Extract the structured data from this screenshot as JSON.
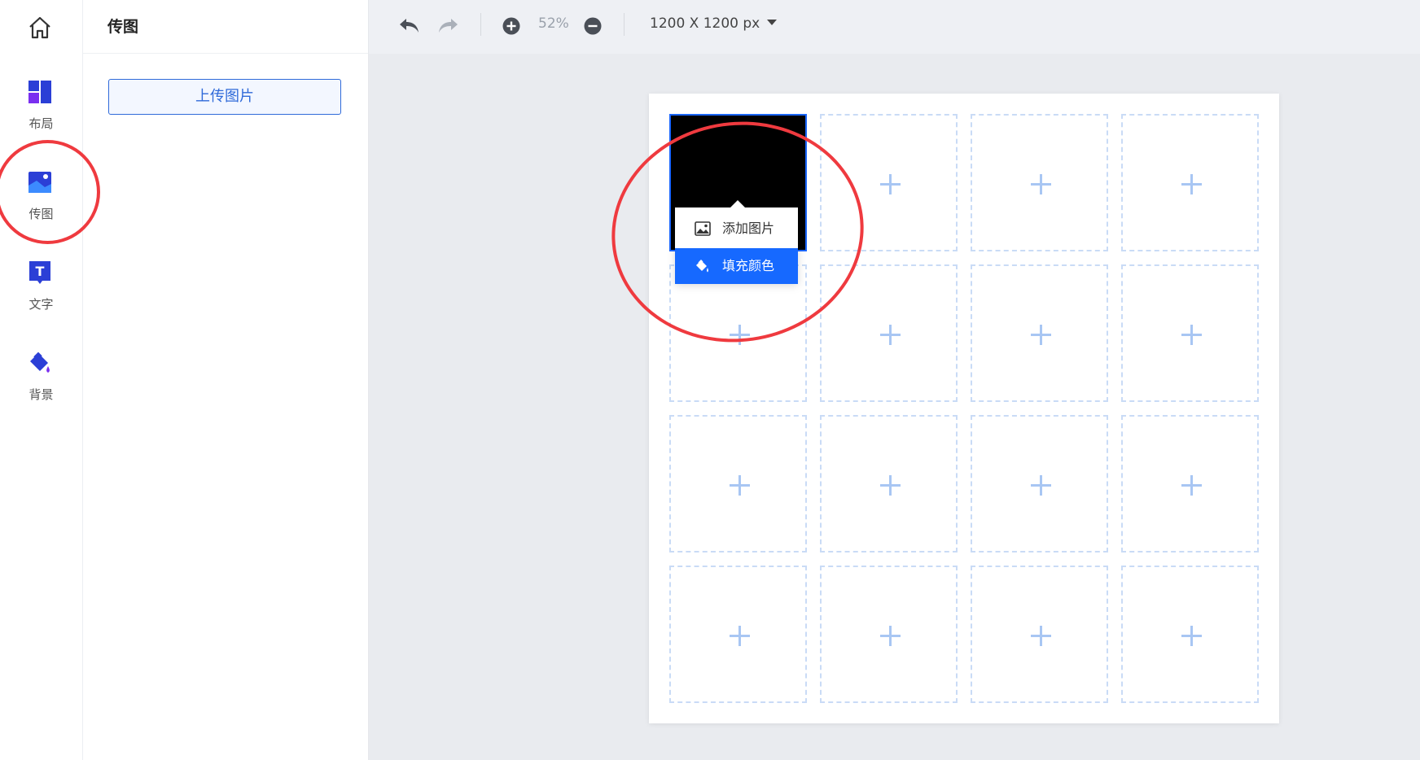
{
  "nav": {
    "items": [
      {
        "label": "布局",
        "icon": "layout-icon"
      },
      {
        "label": "传图",
        "icon": "image-upload-icon"
      },
      {
        "label": "文字",
        "icon": "text-icon"
      },
      {
        "label": "背景",
        "icon": "paint-bucket-icon"
      }
    ]
  },
  "panel": {
    "title": "传图",
    "upload_label": "上传图片"
  },
  "toolbar": {
    "zoom_value": "52%",
    "canvas_size": "1200 X 1200 px"
  },
  "popup": {
    "add_image": "添加图片",
    "fill_color": "填充颜色"
  },
  "grid": {
    "rows": 4,
    "cols": 4,
    "selected_cell": 1
  },
  "colors": {
    "accent": "#1669ff",
    "annotation": "#ef3a3f",
    "dashed_border": "#c9dbf6"
  }
}
